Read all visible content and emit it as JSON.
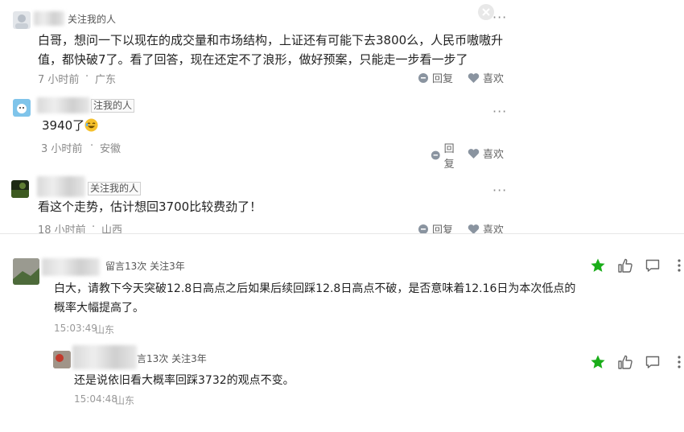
{
  "comments_top": [
    {
      "follow_label": "关注我的人",
      "text_line1": "白哥，想问一下以现在的成交量和市场结构，上证还有可能下去3800么，人民币嗷嗷升",
      "text_line2": "值，都快破7了。看了回答，现在还定不了浪形，做好预案，只能走一步看一步了",
      "time": "7 小时前",
      "location": "广东",
      "reply_label": "回复",
      "like_label": "喜欢"
    },
    {
      "follow_label": "注我的人",
      "text": "3940了",
      "time": "3 小时前",
      "location": "安徽",
      "reply_label": "回复",
      "like_label": "喜欢"
    },
    {
      "follow_label": "关注我的人",
      "text": "看这个走势，估计想回3700比较费劲了！",
      "time": "18 小时前",
      "location": "山西",
      "reply_label": "回复",
      "like_label": "喜欢"
    }
  ],
  "comments_bottom": [
    {
      "stats": "留言13次 关注3年",
      "text_line1": "白大，请教下今天突破12.8日高点之后如果后续回踩12.8日高点不破，是否意味着12.16日为本次低点的",
      "text_line2": "概率大幅提高了。",
      "time": "15:03:49",
      "location": "山东"
    },
    {
      "stats": "言13次 关注3年",
      "text": "还是说依旧看大概率回踩3732的观点不变。",
      "time": "15:04:48",
      "location": "山东"
    }
  ],
  "colors": {
    "accent_green": "#1aad19",
    "meta_gray": "#888888"
  },
  "icons": [
    "close-icon",
    "more-icon",
    "comment-icon",
    "heart-icon",
    "star-icon",
    "thumbs-up-icon",
    "laugh-emoji-icon"
  ]
}
